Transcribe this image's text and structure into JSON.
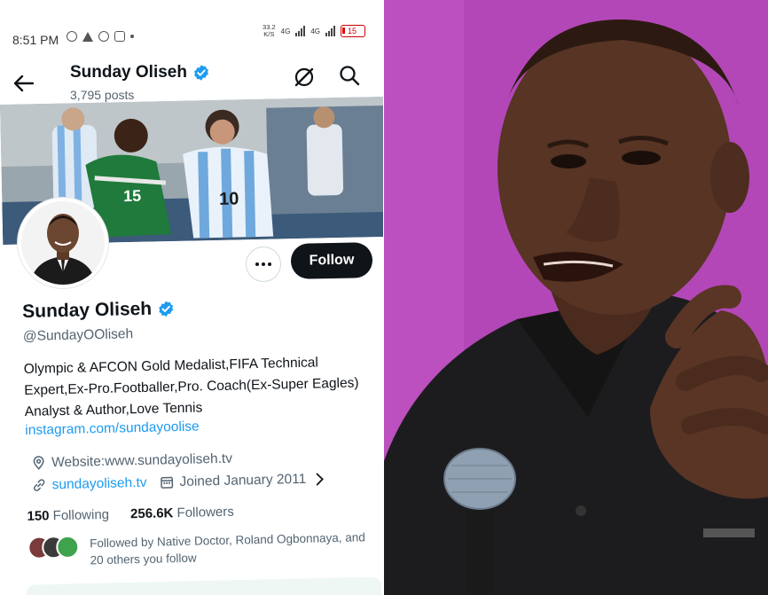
{
  "status_bar": {
    "time": "8:51 PM",
    "net_speed_value": "33.2",
    "net_speed_unit": "K/S",
    "network_1": "4G",
    "network_2": "4G",
    "battery": "15"
  },
  "header": {
    "title": "Sunday Oliseh",
    "posts": "3,795 posts"
  },
  "profile": {
    "name": "Sunday Oliseh",
    "handle": "@SundayOOliseh",
    "bio": "Olympic & AFCON Gold Medalist,FIFA Technical Expert,Ex-Pro.Footballer,Pro. Coach(Ex-Super Eagles) Analyst & Author,Love Tennis",
    "bio_link": "instagram.com/sundayoolise",
    "location": "Website:www.sundayoliseh.tv",
    "website": "sundayoliseh.tv",
    "joined": "Joined January 2011",
    "following_count": "150",
    "following_label": "Following",
    "followers_count": "256.6K",
    "followers_label": "Followers",
    "followed_by": "Followed by Native Doctor, Roland Ogbonnaya, and 20 others you follow"
  },
  "actions": {
    "follow_label": "Follow"
  },
  "banner": {
    "jersey_left_number": "15",
    "jersey_right_number": "10"
  },
  "colors": {
    "accent": "#1d9bf0",
    "follow_button": "#0f1419",
    "photo_background": "#b347b7"
  }
}
